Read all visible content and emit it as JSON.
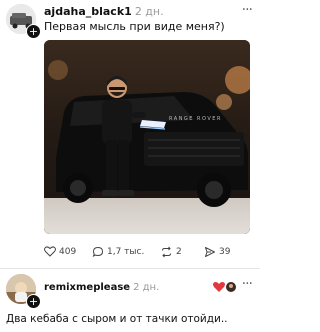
{
  "post1": {
    "username": "ajdaha_black1",
    "time": "2 дн.",
    "caption": "Первая мысль при виде меня?)",
    "more": "···",
    "photo_alt": "",
    "stats": {
      "likes": "409",
      "comments": "1,7 тыс.",
      "reposts": "2",
      "shares": "39"
    }
  },
  "post2": {
    "username": "remixmeplease",
    "time": "2 дн.",
    "caption": "Два кебаба с сыром и от тачки отойди..",
    "more": "···"
  },
  "icons": {
    "like": "heart-icon",
    "comment": "comment-bubble-icon",
    "repost": "repost-arrows-icon",
    "share": "send-arrow-icon",
    "follow": "plus-icon"
  },
  "colors": {
    "text": "#111111",
    "muted": "#9a9a9a",
    "accent_red": "#e0393e"
  }
}
